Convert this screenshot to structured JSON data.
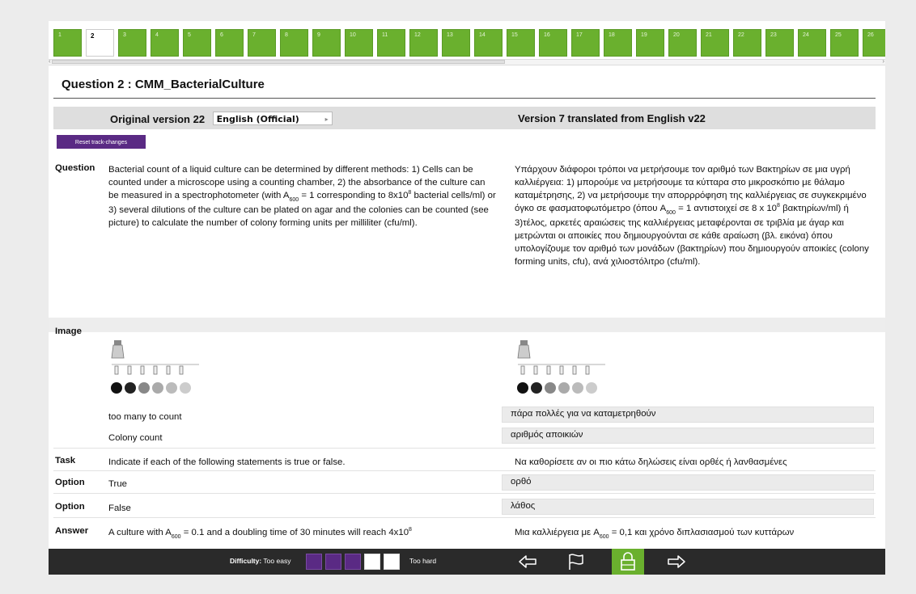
{
  "nav": {
    "tabs": [
      "1",
      "2",
      "3",
      "4",
      "5",
      "6",
      "7",
      "8",
      "9",
      "10",
      "11",
      "12",
      "13",
      "14",
      "15",
      "16",
      "17",
      "18",
      "19",
      "20",
      "21",
      "22",
      "23",
      "24",
      "25",
      "26",
      "27"
    ],
    "active_index": 1,
    "accent": "#6ab02e"
  },
  "question": {
    "title": "Question 2 : CMM_BacterialCulture"
  },
  "header": {
    "original_label": "Original version 22",
    "language_selected": "English (Official)",
    "translation_label": "Version 7 translated from English v22"
  },
  "reset_label": "Reset track-changes",
  "rows": {
    "question_label": "Question",
    "question_orig": {
      "p1": "Bacterial count of a liquid culture can be determined by different methods: 1) Cells can be counted under a microscope using a counting chamber, 2) the absorbance of the culture can be measured in a spectrophotometer (with A",
      "sub": "600",
      "p2": " = 1 corresponding to 8x10",
      "sup": "8",
      "p3": " bacterial cells/ml) or 3) several dilutions of the culture can be plated on agar and the colonies can be counted (see picture) to calculate the number of colony forming units per milliliter (cfu/ml)."
    },
    "question_tr": {
      "p1": "Υπάρχουν διάφοροι τρόποι να μετρήσουμε τον αριθμό των Βακτηρίων σε μια υγρή καλλιέργεια: 1) μπορούμε να μετρήσουμε τα κύτταρα στο μικροσκόπιο με θάλαμο καταμέτρησης,  2) να μετρήσουμε την απορρρόφηση της καλλιέργειας σε συγκεκριμένο όγκο σε φασματοφωτόμετρο (όπου A",
      "sub": "600",
      "p2": " = 1 αντιστοιχεί σε 8 x 10",
      "sup": "8",
      "p3": " βακτηρίων/ml) ή 3)τέλος, αρκετές αραιώσεις της καλλιέργειας μεταφέρονται σε τριβλία με άγαρ και μετρώνται οι αποικίες που δημιουργούνται σε κάθε αραίωση (βλ. εικόνα) όπου υπολογίζουμε τον αριθμό των μονάδων (βακτηρίων)  που δημιουργούν αποικίες (colony forming units, cfu),  ανά χιλιοστόλιτρο (cfu/ml)."
    },
    "image_label": "Image",
    "caption1_orig": "too many to count",
    "caption1_tr": "πάρα πολλές για να καταμετρηθούν",
    "caption2_orig": "Colony count",
    "caption2_tr": "αριθμός αποικιών",
    "task_label": "Task",
    "task_orig": "Indicate if each of the following statements is true or false.",
    "task_tr": "Να καθορίσετε αν οι πιο κάτω δηλώσεις είναι ορθές ή λανθασμένες",
    "option_label": "Option",
    "option1_orig": "True",
    "option1_tr": "ορθό",
    "option2_orig": "False",
    "option2_tr": "λάθος",
    "answer_label": "Answer",
    "answer_orig": {
      "p1": "A culture with A",
      "sub": "600",
      "p2": " = 0.1 and a doubling time of 30 minutes will reach 4x10",
      "sup": "8"
    },
    "answer_tr": {
      "p1": "Μια καλλιέργεια με A",
      "sub": "600",
      "p2": " = 0,1 και χρόνο διπλασιασμού των κυττάρων"
    }
  },
  "bottom": {
    "difficulty_label": "Difficulty:",
    "easy_label": "Too easy",
    "hard_label": "Too hard",
    "difficulty_level": 3,
    "difficulty_max": 5,
    "icons": [
      "arrow-left-icon",
      "flag-icon",
      "lock-icon",
      "arrow-right-icon"
    ]
  }
}
